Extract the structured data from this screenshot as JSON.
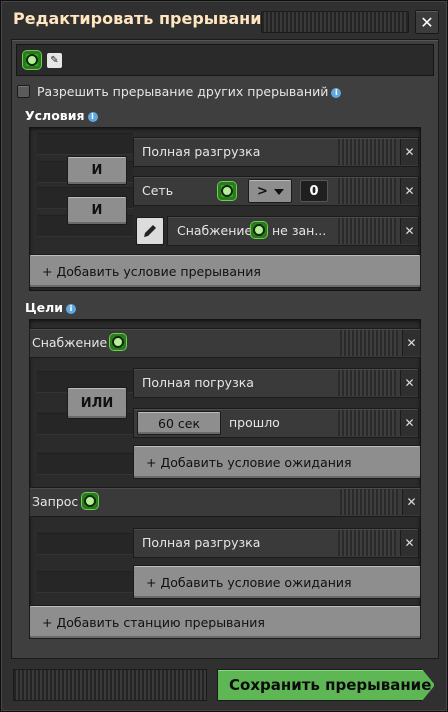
{
  "window": {
    "title": "Редактировать прерывание",
    "close_icon": "close-icon"
  },
  "name_bar": {
    "icon": "circuit-chip-icon",
    "edit_icon": "pencil-icon"
  },
  "allow_nested": {
    "label": "Разрешить прерывание других прерываний",
    "checked": false
  },
  "conditions": {
    "header": "Условия",
    "logic": [
      "И",
      "И"
    ],
    "items": [
      {
        "label": "Полная разгрузка"
      },
      {
        "label": "Сеть",
        "signal_icon": "circuit-chip-icon",
        "operator": ">",
        "value": "0"
      },
      {
        "label_prefix": "Снабжение",
        "label_suffix": "не зан...",
        "signal_icon": "circuit-chip-icon"
      }
    ],
    "add_label": "+ Добавить условие прерывания"
  },
  "targets": {
    "header": "Цели",
    "stations": [
      {
        "name": "Снабжение",
        "logic": "ИЛИ",
        "items": [
          {
            "label": "Полная погрузка"
          },
          {
            "time": "60 сек",
            "label": "прошло"
          }
        ],
        "add_label": "+ Добавить условие ожидания"
      },
      {
        "name": "Запрос",
        "items": [
          {
            "label": "Полная разгрузка"
          }
        ],
        "add_label": "+ Добавить условие ожидания"
      }
    ],
    "add_station_label": "+ Добавить станцию прерывания"
  },
  "footer": {
    "save_label": "Сохранить прерывание"
  },
  "colors": {
    "accent_green": "#5eb654",
    "title": "#ffe6c0",
    "info": "#5fa9e0"
  }
}
